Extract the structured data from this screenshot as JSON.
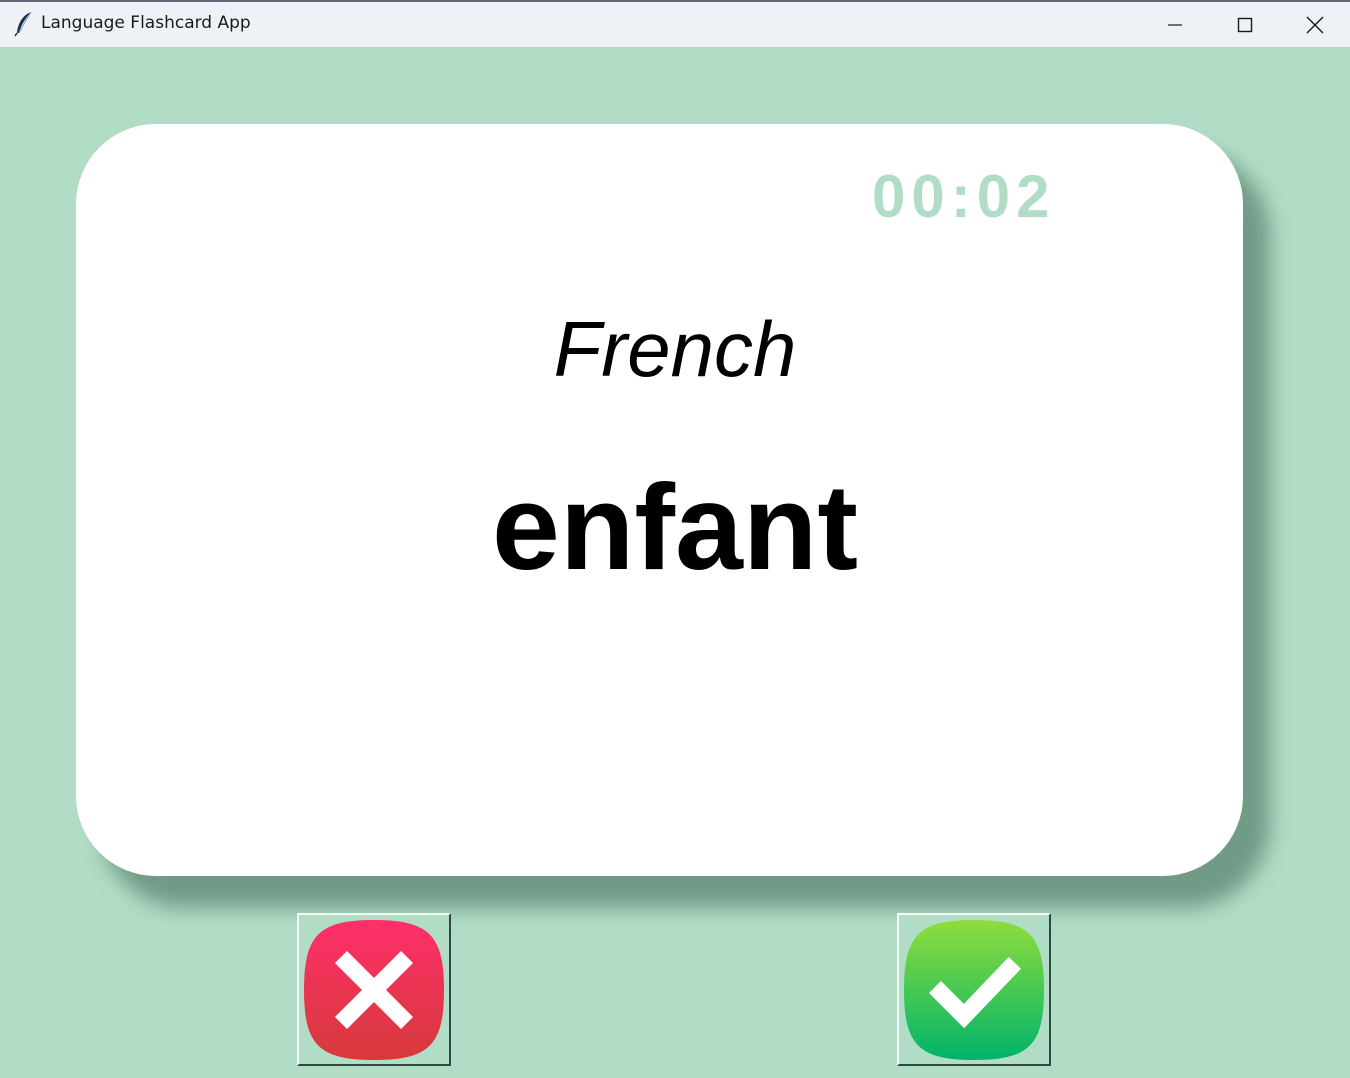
{
  "window": {
    "title": "Language Flashcard App",
    "background_color": "#b1ddc6",
    "icons": {
      "app": "feather-icon",
      "minimize": "minimize-icon",
      "maximize": "maximize-icon",
      "close": "close-icon"
    }
  },
  "card": {
    "timer": "00:02",
    "language": "French",
    "word": "enfant",
    "timer_color": "#b1ddc6"
  },
  "actions": {
    "wrong": {
      "icon": "cross-icon",
      "color": "#e8365a"
    },
    "right": {
      "icon": "checkmark-icon",
      "color": "#2ec25a"
    }
  }
}
